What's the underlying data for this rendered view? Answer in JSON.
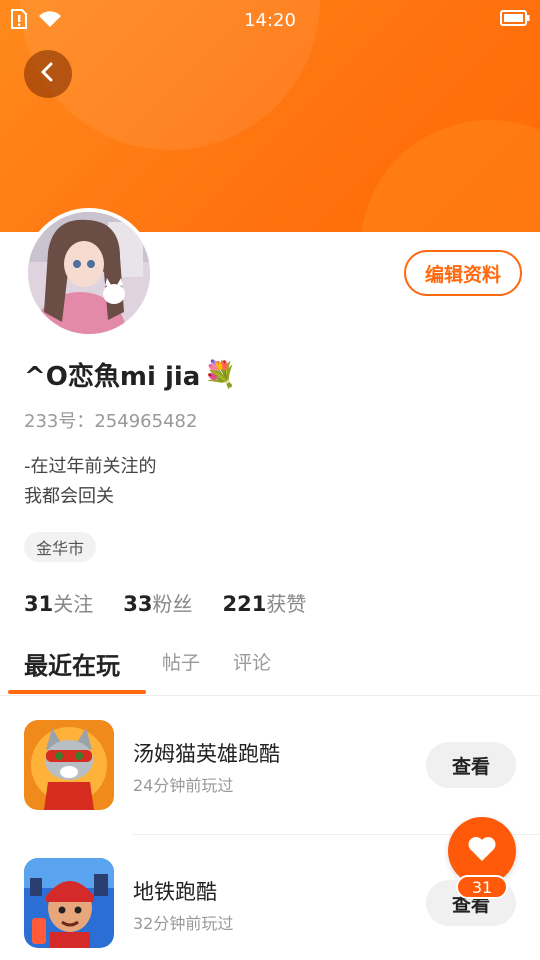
{
  "status_bar": {
    "time": "14:20",
    "icons": [
      "sim-alert-icon",
      "wifi-icon",
      "battery-icon"
    ]
  },
  "header": {
    "back_icon": "chevron-left-icon",
    "accent_color": "#ff6a10"
  },
  "profile": {
    "edit_label": "编辑资料",
    "username": "^O恋魚mi jia",
    "username_emoji": "💐",
    "user_id": "233号：254965482",
    "bio_lines": [
      "-在过年前关注的",
      "我都会回关"
    ],
    "location": "金华市",
    "stats": [
      {
        "num": "31",
        "label": "关注"
      },
      {
        "num": "33",
        "label": "粉丝"
      },
      {
        "num": "221",
        "label": "获赞"
      }
    ]
  },
  "tabs": [
    {
      "label": "最近在玩",
      "active": true
    },
    {
      "label": "帖子",
      "active": false
    },
    {
      "label": "评论",
      "active": false
    }
  ],
  "games": [
    {
      "title": "汤姆猫英雄跑酷",
      "subtitle": "24分钟前玩过",
      "button": "查看"
    },
    {
      "title": "地铁跑酷",
      "subtitle": "32分钟前玩过",
      "button": "查看"
    }
  ],
  "fab": {
    "icon": "heart-icon",
    "count": "31"
  }
}
